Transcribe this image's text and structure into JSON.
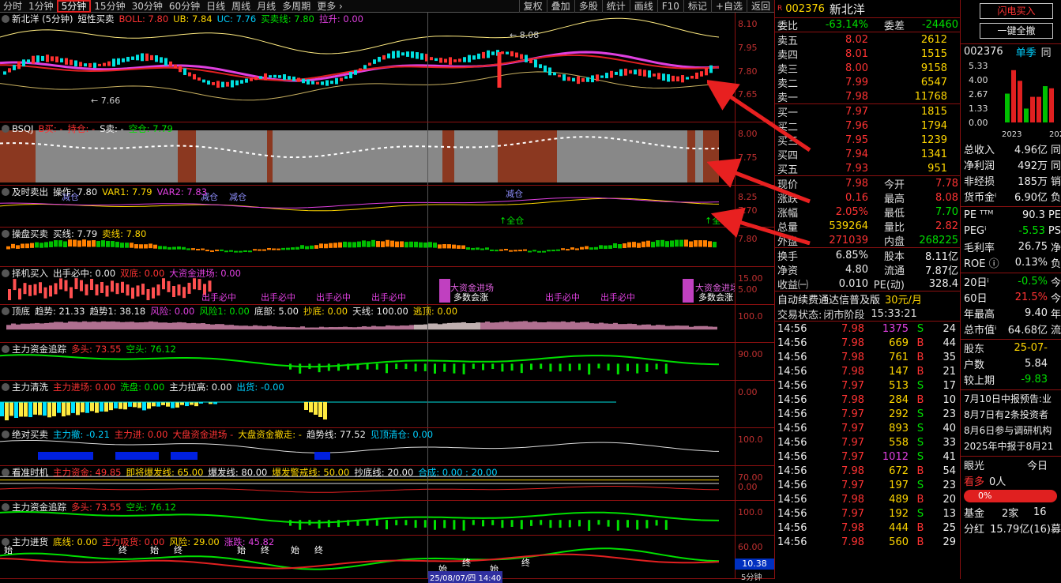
{
  "toolbar": {
    "periods": [
      "分时",
      "1分钟",
      "5分钟",
      "15分钟",
      "30分钟",
      "60分钟",
      "日线",
      "周线",
      "月线",
      "多周期",
      "更多 ›"
    ],
    "selected": "5分钟",
    "tools": [
      "复权",
      "叠加",
      "多股",
      "统计",
      "画线",
      "F10",
      "标记",
      "+自选",
      "返回"
    ]
  },
  "panels": [
    {
      "key": "main",
      "items": [
        [
          "新北洋 (5分钟)",
          "wht"
        ],
        [
          "短性买卖",
          "wht"
        ],
        [
          "BOLL: 7.80",
          "red"
        ],
        [
          "UB: 7.84",
          "yel"
        ],
        [
          "UC: 7.76",
          "cyan"
        ],
        [
          "买卖线: 7.80",
          "green"
        ],
        [
          "拉升: 0.00",
          "mag"
        ]
      ],
      "ylabels": [
        "8.10",
        "7.95",
        "7.80",
        "7.65"
      ]
    },
    {
      "key": "bsqj",
      "items": [
        [
          "BSQJ",
          "wht"
        ],
        [
          "B买: -",
          "red"
        ],
        [
          "持仓: -",
          "red"
        ],
        [
          "S卖: -",
          "wht"
        ],
        [
          "空仓: 7.79",
          "green"
        ]
      ],
      "ylabels": [
        "8.00",
        "7.75"
      ]
    },
    {
      "key": "jishi",
      "items": [
        [
          "及时卖出",
          "wht"
        ],
        [
          "操作: 7.80",
          "wht"
        ],
        [
          "VAR1: 7.79",
          "yel"
        ],
        [
          "VAR2: 7.83",
          "mag"
        ]
      ],
      "ylabels": [
        "8.25",
        "7.70"
      ]
    },
    {
      "key": "caopan",
      "items": [
        [
          "操盘买卖",
          "wht"
        ],
        [
          "买线: 7.79",
          "wht"
        ],
        [
          "卖线: 7.80",
          "yel"
        ]
      ],
      "ylabels": [
        "7.80"
      ]
    },
    {
      "key": "zeji",
      "items": [
        [
          "择机买入",
          "wht"
        ],
        [
          "出手必中: 0.00",
          "wht"
        ],
        [
          "双底: 0.00",
          "red"
        ],
        [
          "大资金进场: 0.00",
          "mag"
        ]
      ],
      "ylabels": [
        "15.00",
        "5.00"
      ]
    },
    {
      "key": "dingdi",
      "items": [
        [
          "顶底",
          "wht"
        ],
        [
          "趋势: 21.33",
          "wht"
        ],
        [
          "趋势1: 38.18",
          "wht"
        ],
        [
          "风险: 0.00",
          "mag"
        ],
        [
          "风险1: 0.00",
          "green"
        ],
        [
          "底部: 5.00",
          "wht"
        ],
        [
          "抄底: 0.00",
          "yel"
        ],
        [
          "天线: 100.00",
          "wht"
        ],
        [
          "逃顶: 0.00",
          "yel"
        ]
      ],
      "ylabels": [
        "100.0"
      ]
    },
    {
      "key": "zhuli1",
      "items": [
        [
          "主力资金追踪",
          "wht"
        ],
        [
          "多头: 73.55",
          "red"
        ],
        [
          "空头: 76.12",
          "green"
        ]
      ],
      "ylabels": [
        "90.00"
      ]
    },
    {
      "key": "qingxi",
      "items": [
        [
          "主力清洗",
          "wht"
        ],
        [
          "主力进场: 0.00",
          "red"
        ],
        [
          "洗盘: 0.00",
          "green"
        ],
        [
          "主力拉高: 0.00",
          "wht"
        ],
        [
          "出货: -0.00",
          "cyan"
        ]
      ],
      "ylabels": [
        "0.00"
      ]
    },
    {
      "key": "juedui",
      "items": [
        [
          "绝对买卖",
          "wht"
        ],
        [
          "主力撤: -0.21",
          "cyan"
        ],
        [
          "主力进: 0.00",
          "red"
        ],
        [
          "大盘资金进场 -",
          "red"
        ],
        [
          "大盘资金撤走: -",
          "yel"
        ],
        [
          "趋势线: 77.52",
          "wht"
        ],
        [
          "见顶清仓: 0.00",
          "cyan"
        ]
      ],
      "ylabels": [
        "100.0"
      ]
    },
    {
      "key": "kanzhun",
      "items": [
        [
          "看准时机",
          "wht"
        ],
        [
          "主力资金: 49.85",
          "red"
        ],
        [
          "即将爆发线: 65.00",
          "yel"
        ],
        [
          "爆发线: 80.00",
          "wht"
        ],
        [
          "爆发警戒线: 50.00",
          "yel"
        ],
        [
          "抄底线: 20.00",
          "wht"
        ],
        [
          "合成: 0.00 : 20.00",
          "cyan"
        ]
      ],
      "ylabels": [
        "70.00",
        "0.00"
      ]
    },
    {
      "key": "zhuli2",
      "items": [
        [
          "主力资金追踪",
          "wht"
        ],
        [
          "多头: 73.55",
          "red"
        ],
        [
          "空头: 76.12",
          "green"
        ]
      ],
      "ylabels": [
        "100.0"
      ]
    },
    {
      "key": "jinhuo",
      "items": [
        [
          "主力进货",
          "wht"
        ],
        [
          "底线: 0.00",
          "yel"
        ],
        [
          "主力吸货: 0.00",
          "red"
        ],
        [
          "风险: 29.00",
          "yel"
        ],
        [
          "涨跌: 45.82",
          "mag"
        ]
      ],
      "ylabels": [
        "60.00"
      ]
    }
  ],
  "annotations": {
    "high": "8.08",
    "low": "7.66",
    "bottom_value": "10.38",
    "period_tag": "5分钟",
    "date_tag": "25/08/07/四 14:40"
  },
  "chart_marks": [
    "减仓",
    "减仓",
    "减仓",
    "减仓",
    "↑全仓",
    "↑全仓",
    "出手必中",
    "出手必中",
    "出手必中",
    "出手必中",
    "出手必中",
    "大资金进场",
    "大资金进场",
    "多数会涨",
    "多数会涨",
    "出手必中",
    "始",
    "终",
    "始",
    "终",
    "始",
    "终",
    "始",
    "终",
    "始",
    "终",
    "始",
    "终",
    "始",
    "终",
    "始",
    "终",
    "始",
    "终",
    "始",
    "止",
    "始",
    "止"
  ],
  "right": {
    "code": "002376",
    "name": "新北洋",
    "weibi_label": "委比",
    "weibi": "-63.14%",
    "weicha_label": "委差",
    "weicha": "-24460",
    "sells": [
      [
        "卖五",
        "8.02",
        "2612"
      ],
      [
        "卖四",
        "8.01",
        "1515"
      ],
      [
        "卖三",
        "8.00",
        "9158"
      ],
      [
        "卖二",
        "7.99",
        "6547"
      ],
      [
        "卖一",
        "7.98",
        "11768"
      ]
    ],
    "buys": [
      [
        "买一",
        "7.97",
        "1815"
      ],
      [
        "买二",
        "7.96",
        "1794"
      ],
      [
        "买三",
        "7.95",
        "1239"
      ],
      [
        "买四",
        "7.94",
        "1341"
      ],
      [
        "买五",
        "7.93",
        "951"
      ]
    ],
    "stats": [
      [
        "现价",
        "7.98",
        "今开",
        "7.78"
      ],
      [
        "涨跌",
        "0.16",
        "最高",
        "8.08"
      ],
      [
        "涨幅",
        "2.05%",
        "最低",
        "7.70"
      ],
      [
        "总量",
        "539264",
        "量比",
        "2.82"
      ],
      [
        "外盘",
        "271039",
        "内盘",
        "268225"
      ]
    ],
    "stats2": [
      [
        "换手",
        "6.85%",
        "股本",
        "8.11亿"
      ],
      [
        "净资",
        "4.80",
        "流通",
        "7.87亿"
      ],
      [
        "收益㈠",
        "0.010",
        "PE(动)",
        "328.4"
      ]
    ],
    "fee_text": "自动续费通达信普及版",
    "fee_price": "30元/月",
    "status_label": "交易状态:",
    "status_value": "闭市阶段",
    "status_time": "15:33:21",
    "ticks": [
      [
        "14:56",
        "7.98",
        "1375",
        "S",
        "24"
      ],
      [
        "14:56",
        "7.98",
        "669",
        "B",
        "44"
      ],
      [
        "14:56",
        "7.98",
        "761",
        "B",
        "35"
      ],
      [
        "14:56",
        "7.98",
        "147",
        "B",
        "21"
      ],
      [
        "14:56",
        "7.97",
        "513",
        "S",
        "17"
      ],
      [
        "14:56",
        "7.98",
        "284",
        "B",
        "10"
      ],
      [
        "14:56",
        "7.97",
        "292",
        "S",
        "23"
      ],
      [
        "14:56",
        "7.97",
        "893",
        "S",
        "40"
      ],
      [
        "14:56",
        "7.97",
        "558",
        "S",
        "33"
      ],
      [
        "14:56",
        "7.97",
        "1012",
        "S",
        "41"
      ],
      [
        "14:56",
        "7.98",
        "672",
        "B",
        "54"
      ],
      [
        "14:56",
        "7.97",
        "197",
        "S",
        "23"
      ],
      [
        "14:56",
        "7.98",
        "489",
        "B",
        "20"
      ],
      [
        "14:56",
        "7.97",
        "192",
        "S",
        "13"
      ],
      [
        "14:56",
        "7.98",
        "444",
        "B",
        "25"
      ],
      [
        "14:56",
        "7.98",
        "560",
        "B",
        "29"
      ]
    ]
  },
  "far": {
    "btn1": "闪电买入",
    "btn2": "一键全撤",
    "code": "002376",
    "tab1": "单季",
    "tab2": "同",
    "bar_y": [
      "5.33",
      "4.00",
      "2.67",
      "1.33",
      "0.00"
    ],
    "bar_x": [
      "2023",
      "202"
    ],
    "bars": [
      {
        "v": 2.7,
        "c": "#00c000"
      },
      {
        "v": 4.9,
        "c": "#e02020"
      },
      {
        "v": 3.9,
        "c": "#e02020"
      },
      {
        "v": 1.3,
        "c": "#00c000"
      },
      {
        "v": 2.4,
        "c": "#e02020"
      },
      {
        "v": 2.4,
        "c": "#e02020"
      },
      {
        "v": 3.4,
        "c": "#00c000"
      },
      {
        "v": 3.2,
        "c": "#e02020"
      }
    ],
    "fin": [
      [
        "总收入",
        "4.96亿",
        "同"
      ],
      [
        "净利润",
        "492万",
        "同"
      ],
      [
        "非经损",
        "185万",
        "销"
      ],
      [
        "货币金ⁱ",
        "6.90亿",
        "负"
      ]
    ],
    "fin2": [
      [
        "PE ᵀᵀᴹ",
        "90.3",
        "PE"
      ],
      [
        "PEGⁱ",
        "-5.53",
        "PS"
      ],
      [
        "毛利率",
        "26.75",
        "净"
      ],
      [
        "ROE ⓘ",
        "0.13%",
        "负"
      ]
    ],
    "perf": [
      [
        "20日ⁱ",
        "-0.5%",
        "今"
      ],
      [
        "60日",
        "21.5%",
        "今"
      ],
      [
        "年最高",
        "9.40",
        "年"
      ],
      [
        "总市值ⁱ",
        "64.68亿",
        "流"
      ]
    ],
    "holders": [
      [
        "股东",
        "25-07-"
      ],
      [
        "户数",
        "5.84"
      ],
      [
        "较上期",
        "-9.83"
      ]
    ],
    "news": [
      "7月10日中报预告:业",
      "8月7日有2条投资者",
      "8月6日参与调研机构",
      "2025年中报于8月21"
    ],
    "eye": "眼光",
    "today": "今日",
    "kanduo": "看多",
    "kanduo_n": "0人",
    "pct": "0%",
    "fund_label": "基金",
    "fund_val": "2家",
    "fund_tail": "16",
    "div_label": "分红",
    "div_val": "15.79亿(16)",
    "div_tail": "募"
  },
  "colors": {
    "up": "#ff3333",
    "down": "#00e000",
    "accent": "#e02020",
    "border": "#8b1010"
  }
}
